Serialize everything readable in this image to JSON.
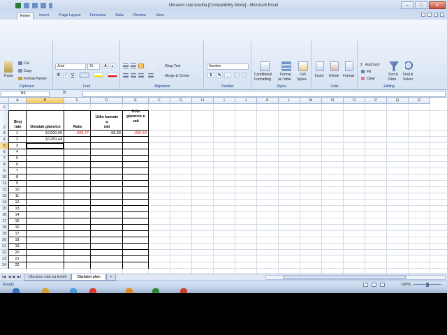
{
  "window": {
    "title": "Obracun rate kredita  [Compatibility Mode] - Microsoft Excel",
    "minimize": "–",
    "maximize": "□",
    "close": "x"
  },
  "tabs": [
    "Home",
    "Insert",
    "Page Layout",
    "Formulas",
    "Data",
    "Review",
    "View"
  ],
  "ribbon": {
    "clipboard": {
      "paste": "Paste",
      "cut": "Cut",
      "copy": "Copy",
      "format_painter": "Format Painter",
      "label": "Clipboard"
    },
    "font": {
      "name": "Arial",
      "size": "10",
      "grow": "A",
      "shrink": "A",
      "bold": "B",
      "italic": "I",
      "underline": "U",
      "label": "Font"
    },
    "alignment": {
      "wrap": "Wrap Text",
      "merge": "Merge & Center",
      "label": "Alignment"
    },
    "number": {
      "format": "Number",
      "currency": "$",
      "percent": "%",
      "comma": ",",
      "label": "Number"
    },
    "styles": {
      "conditional": [
        "Conditional",
        "Formatting"
      ],
      "format_table": [
        "Format",
        "as Table"
      ],
      "cell_styles": [
        "Cell",
        "Styles"
      ],
      "label": "Styles"
    },
    "cells": {
      "insert": "Insert",
      "delete": "Delete",
      "format": "Format",
      "label": "Cells"
    },
    "editing": {
      "autosum": "AutoSum",
      "fill": "Fill",
      "clear": "Clear",
      "sort": [
        "Sort &",
        "Filter"
      ],
      "find": [
        "Find &",
        "Select"
      ],
      "label": "Editing"
    }
  },
  "formula_bar": {
    "name_box": "B5",
    "fx": "fx",
    "content": ""
  },
  "columns": [
    "A",
    "B",
    "C",
    "D",
    "E",
    "F",
    "G",
    "H",
    "I",
    "J",
    "K",
    "L",
    "M",
    "N",
    "O",
    "P",
    "Q",
    "R"
  ],
  "rows": [
    "1",
    "2",
    "3",
    "4",
    "5",
    "6",
    "7",
    "8",
    "9",
    "10",
    "11",
    "12",
    "13",
    "14",
    "15",
    "16",
    "17",
    "18",
    "19",
    "20",
    "21",
    "22",
    "23",
    "24"
  ],
  "table": {
    "headers": {
      "broj_rate": [
        "Broj",
        "rate"
      ],
      "ostatak": "Ostatak glavnice",
      "rata": "Rata",
      "udio_kamate": [
        "Udio kamate",
        "u",
        "rati"
      ],
      "udio_glavnice": [
        "Udio",
        "glavnice u",
        "rati"
      ]
    },
    "rate_numbers": [
      "1",
      "2",
      "3",
      "4",
      "5",
      "6",
      "7",
      "8",
      "9",
      "10",
      "11",
      "12",
      "13",
      "14",
      "15",
      "16",
      "17",
      "18",
      "19",
      "20",
      "21",
      "22"
    ],
    "ostatak": [
      "10.000,00",
      "10.250,44"
    ],
    "rata": [
      "-308,77"
    ],
    "udio_kamate": [
      "-58,33"
    ],
    "udio_glavnice": [
      "-250,44"
    ]
  },
  "sheets": [
    "Obračun rate za kredit",
    "Otplatni plan"
  ],
  "active_sheet": 1,
  "status": {
    "text": "Ready",
    "zoom": "100%"
  }
}
